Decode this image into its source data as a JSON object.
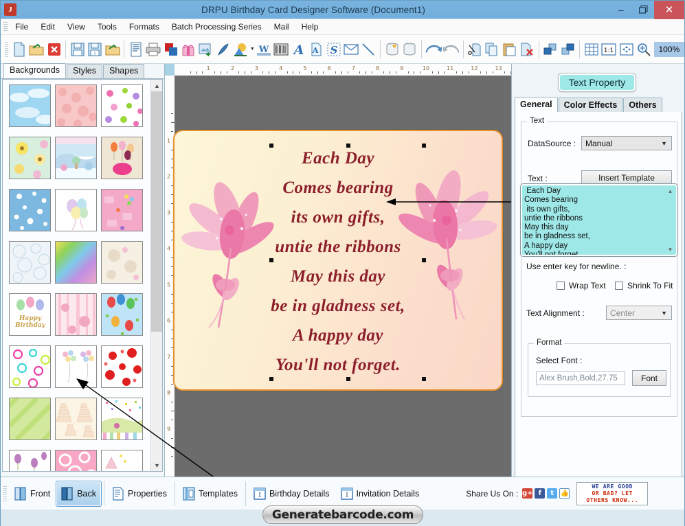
{
  "window": {
    "title": "DRPU Birthday Card Designer Software (Document1)",
    "app_icon": "J",
    "minimize": "–",
    "restore": "❐",
    "close": "✕"
  },
  "menubar": {
    "items": [
      "File",
      "Edit",
      "View",
      "Tools",
      "Formats",
      "Batch Processing Series",
      "Mail",
      "Help"
    ]
  },
  "toolbar": {
    "zoom_value": "100%",
    "groups": [
      [
        "new-document-icon",
        "open-folder-icon",
        "close-document-icon"
      ],
      [
        "save-icon",
        "save-as-icon",
        "import-folder-icon"
      ],
      [
        "page-setup-icon",
        "print-icon",
        "layers-icon",
        "gift-icon",
        "add-image-icon",
        "pen-icon",
        "shape-fill-icon",
        "watermark-icon",
        "barcode-icon",
        "text-icon",
        "text-page-icon",
        "signature-icon",
        "envelope-icon",
        "line-icon"
      ],
      [
        "database-gold-icon",
        "database-icon"
      ],
      [
        "undo-icon",
        "redo-icon"
      ],
      [
        "cut-icon",
        "copy-icon",
        "paste-icon",
        "delete-icon"
      ],
      [
        "bring-to-front-icon",
        "send-to-back-icon"
      ],
      [
        "grid-icon",
        "actual-size-icon",
        "fit-page-icon",
        "zoom-icon"
      ]
    ]
  },
  "left_panel": {
    "tabs": [
      {
        "label": "Backgrounds",
        "active": true
      },
      {
        "label": "Styles",
        "active": false
      },
      {
        "label": "Shapes",
        "active": false
      }
    ],
    "thumbnails": [
      {
        "name": "clouds-sky"
      },
      {
        "name": "pink-hearts-pattern"
      },
      {
        "name": "colorful-flowers-white"
      },
      {
        "name": "yellow-daisies-green"
      },
      {
        "name": "winter-scene-pastel"
      },
      {
        "name": "balloons-beige"
      },
      {
        "name": "stars-blue"
      },
      {
        "name": "pastel-balloons-white"
      },
      {
        "name": "birthday-cakes-pink"
      },
      {
        "name": "bubbles-white"
      },
      {
        "name": "rainbow-gradient"
      },
      {
        "name": "teddy-bears-beige"
      },
      {
        "name": "happy-birthday-banner"
      },
      {
        "name": "pink-stripes-hearts"
      },
      {
        "name": "balloons-blue-sky"
      },
      {
        "name": "neon-hearts-pink"
      },
      {
        "name": "balloon-bunches-white"
      },
      {
        "name": "red-hearts-white"
      },
      {
        "name": "green-diagonal-stripes"
      },
      {
        "name": "cream-cakes-pattern"
      },
      {
        "name": "confetti-meadow"
      },
      {
        "name": "purple-tulips-white"
      },
      {
        "name": "pink-hearts-outline"
      },
      {
        "name": "party-hats-white"
      }
    ]
  },
  "canvas": {
    "h_ruler_labels": [
      "1",
      "2",
      "3",
      "4",
      "5",
      "6",
      "7",
      "8",
      "9",
      "10",
      "11",
      "12",
      "13"
    ],
    "v_ruler_labels": [
      "1",
      "2",
      "3",
      "4",
      "5",
      "6",
      "7",
      "8",
      "9"
    ],
    "card": {
      "poem_lines": [
        "Each Day",
        "Comes bearing",
        "its own gifts,",
        "untie the ribbons",
        "May this day",
        "be in gladness set,",
        "A happy day",
        "You'll not forget."
      ]
    }
  },
  "right_panel": {
    "header_button": "Text Property",
    "tabs": [
      {
        "label": "General",
        "active": true
      },
      {
        "label": "Color Effects",
        "active": false
      },
      {
        "label": "Others",
        "active": false
      }
    ],
    "text_group": {
      "legend": "Text",
      "datasource_label": "DataSource :",
      "datasource_value": "Manual",
      "text_label": "Text :",
      "insert_template_button": "Insert Template",
      "textarea_value": " Each Day\nComes bearing\n its own gifts,\nuntie the ribbons\nMay this day\nbe in gladness set,\nA happy day\nYou'll not forget.",
      "hint": "Use enter key for newline. :",
      "wrap_text_label": "Wrap Text",
      "wrap_text_checked": false,
      "shrink_to_fit_label": "Shrink To Fit",
      "shrink_to_fit_checked": false,
      "alignment_label": "Text Alignment :",
      "alignment_value": "Center"
    },
    "format_group": {
      "legend": "Format",
      "select_font_label": "Select Font :",
      "font_value": "Alex Brush,Bold,27.75",
      "font_button": "Font"
    }
  },
  "bottom_bar": {
    "items": [
      {
        "label": "Front",
        "icon": "card-front-icon",
        "active": false
      },
      {
        "label": "Back",
        "icon": "card-back-icon",
        "active": true
      },
      {
        "label": "Properties",
        "icon": "properties-icon",
        "active": false
      },
      {
        "label": "Templates",
        "icon": "templates-icon",
        "active": false
      },
      {
        "label": "Birthday Details",
        "icon": "birthday-details-icon",
        "active": false
      },
      {
        "label": "Invitation Details",
        "icon": "invitation-details-icon",
        "active": false
      }
    ],
    "share_label": "Share Us On :",
    "share_icons": [
      {
        "name": "google-plus-icon",
        "glyph": "g+",
        "color": "#d34836"
      },
      {
        "name": "facebook-icon",
        "glyph": "f",
        "color": "#3b5998"
      },
      {
        "name": "twitter-icon",
        "glyph": "t",
        "color": "#55acee"
      },
      {
        "name": "like-icon",
        "glyph": "ὄd",
        "color": "#ffffff"
      }
    ],
    "feedback_badge": {
      "line1": "WE ARE GOOD",
      "line2": "OR BAD? LET",
      "line3": "OTHERS KNOW...",
      "color_blue": "#1f3a93",
      "color_red": "#cc2200"
    }
  },
  "watermark": "Generatebarcode.com",
  "colors": {
    "titlebar": "#78b2de",
    "close_button": "#c9555a",
    "accent_cyan": "#9fe8e8",
    "card_border": "#e8922c",
    "poem_text": "#8c1f2c",
    "canvas_bg": "#6c6c6c"
  }
}
